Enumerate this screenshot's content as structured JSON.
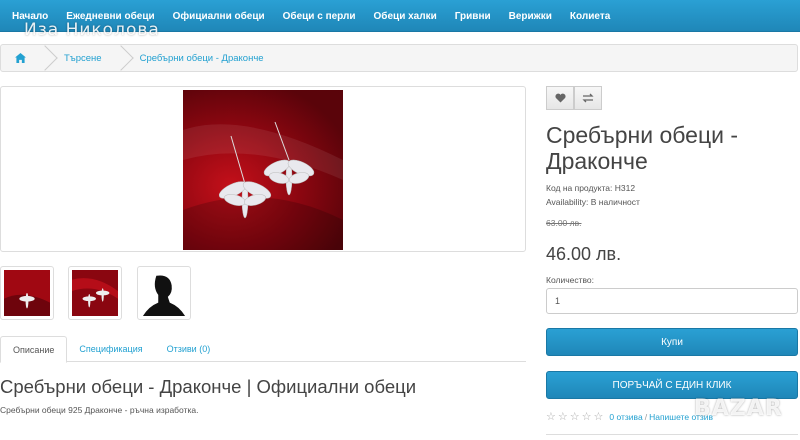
{
  "watermark": "Иза Николова",
  "nav": {
    "items": [
      "Начало",
      "Ежедневни обеци",
      "Официални обеци",
      "Обеци с перли",
      "Обеци халки",
      "Гривни",
      "Верижки",
      "Колиета"
    ]
  },
  "breadcrumb": {
    "home_icon": "home-icon",
    "items": [
      "Търсене",
      "Сребърни обеци - Драконче"
    ]
  },
  "product": {
    "title": "Сребърни обеци - Драконче",
    "code_label": "Код на продукта: Н312",
    "availability": "Availability: В наличност",
    "old_price": "63.00 лв.",
    "price": "46.00 лв.",
    "qty_label": "Количество:",
    "qty_value": "1",
    "buy_label": "Купи",
    "one_click_label": "ПОРЪЧАЙ С ЕДИН КЛИК",
    "reviews_link": "0 отзива",
    "write_review": "Напишете отзив",
    "rating": 0,
    "rating_max": 5
  },
  "tabs": [
    "Описание",
    "Спецификация",
    "Отзиви (0)"
  ],
  "active_tab": "Описание",
  "description": {
    "heading": "Сребърни обеци - Драконче | Официални обеци",
    "text": "Сребърни обеци 925 Драконче - ръчна изработка."
  },
  "site_watermark": "BAZAR",
  "colors": {
    "accent": "#2aa0d4",
    "link": "#23a1d1",
    "photo_background": "#8a0610"
  }
}
